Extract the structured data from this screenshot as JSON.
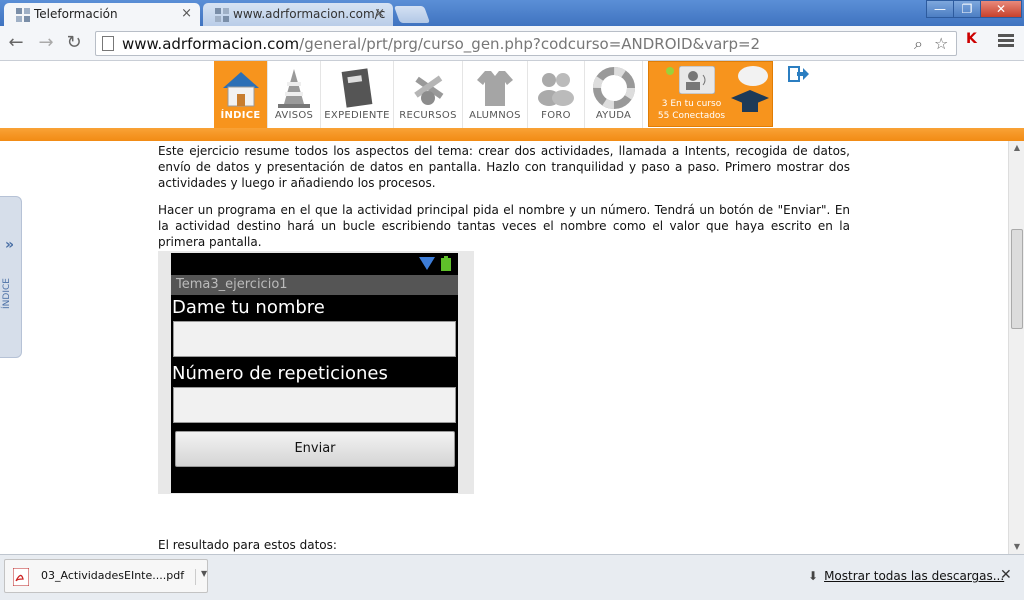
{
  "browser": {
    "tabs": [
      {
        "title": "Teleformación"
      },
      {
        "title": "www.adrformacion.com/c"
      }
    ],
    "close_glyph": "×",
    "window": {
      "min": "—",
      "max": "❐",
      "close": "✕"
    },
    "url_host": "www.adrformacion.com",
    "url_path": "/general/prt/prg/curso_gen.php?codcurso=ANDROID&varp=2",
    "icons": {
      "back": "arrow-left-icon",
      "forward": "arrow-right-icon",
      "reload": "reload-icon",
      "zoom": "magnifier-icon",
      "star": "star-icon",
      "menu": "hamburger-menu-icon"
    }
  },
  "site_nav": {
    "items": [
      {
        "label": "ÍNDICE",
        "icon": "house-icon",
        "active": true
      },
      {
        "label": "AVISOS",
        "icon": "traffic-cone-icon"
      },
      {
        "label": "EXPEDIENTE",
        "icon": "notebook-icon"
      },
      {
        "label": "RECURSOS",
        "icon": "tools-icon"
      },
      {
        "label": "ALUMNOS",
        "icon": "tshirt-icon"
      },
      {
        "label": "FORO",
        "icon": "people-icon"
      },
      {
        "label": "AYUDA",
        "icon": "lifebuoy-icon"
      }
    ],
    "curso_line1": "3 En tu curso",
    "curso_line2": "55 Conectados",
    "accent": "#f7941d"
  },
  "content": {
    "p1": "Este ejercicio resume todos los aspectos del tema: crear dos actividades, llamada a Intents, recogida de datos, envío de datos y presentación de datos en pantalla. Hazlo con tranquilidad y paso a paso. Primero mostrar dos actividades y luego ir añadiendo los procesos.",
    "p2": "Hacer un programa en el que la actividad principal pida el nombre y un número. Tendrá un botón de \"Enviar\". En la actividad destino hará un bucle escribiendo tantas veces el nombre como el valor que haya escrito en la primera pantalla.",
    "p3": "El resultado para estos datos:",
    "phone": {
      "app_title": "Tema3_ejercicio1",
      "label_name": "Dame tu nombre",
      "label_reps": "Número de repeticiones",
      "button": "Enviar"
    }
  },
  "sidetab": {
    "label": "ÍNDICE",
    "chevron": "»"
  },
  "downloads": {
    "file": "03_ActividadesEInte....pdf",
    "show_all": "Mostrar todas las descargas...",
    "close": "✕"
  }
}
